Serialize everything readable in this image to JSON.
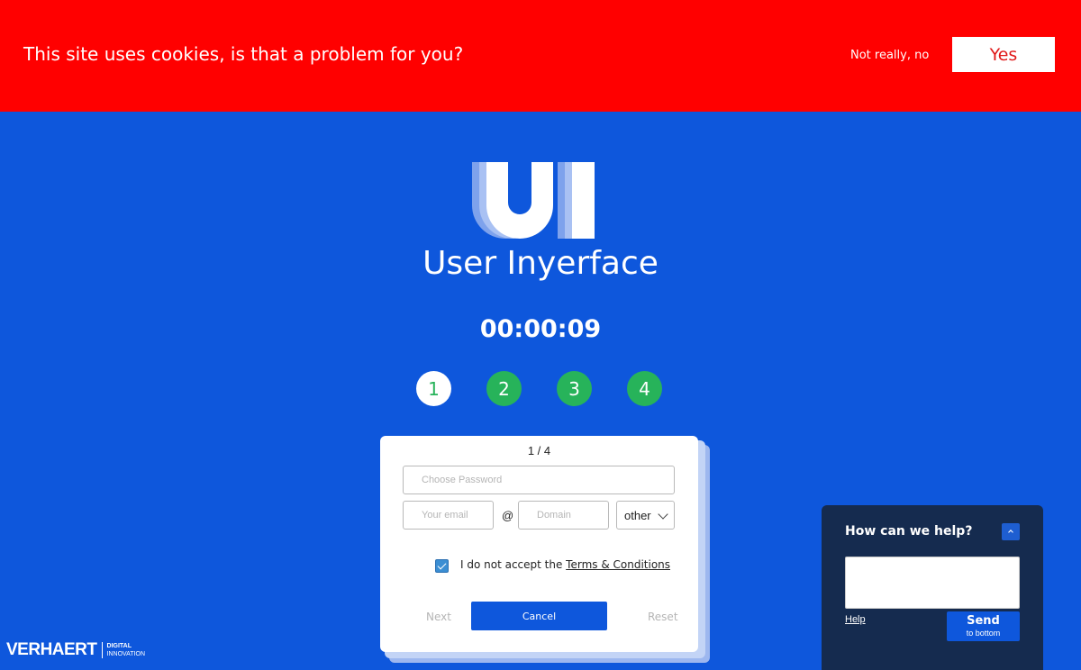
{
  "cookie_banner": {
    "message": "This site uses cookies, is that a problem for you?",
    "decline_label": "Not really, no",
    "accept_label": "Yes"
  },
  "app": {
    "title": "User Inyerface",
    "logo_icon": "ui-logo",
    "timer": "00:00:09"
  },
  "steps": [
    {
      "label": "1",
      "state": "active"
    },
    {
      "label": "2",
      "state": "todo"
    },
    {
      "label": "3",
      "state": "todo"
    },
    {
      "label": "4",
      "state": "todo"
    }
  ],
  "form": {
    "step_indicator": "1 / 4",
    "password_placeholder": "Choose Password",
    "email_placeholder": "Your email",
    "at_symbol": "@",
    "domain_placeholder": "Domain",
    "tld_selected": "other",
    "terms_checked": true,
    "terms_prefix": "I do not accept the ",
    "terms_link": "Terms & Conditions",
    "next_label": "Next",
    "cancel_label": "Cancel",
    "reset_label": "Reset"
  },
  "brand": {
    "name": "VERHAERT",
    "sub_line1": "DIGITAL",
    "sub_line2": "INNOVATION"
  },
  "help_widget": {
    "title": "How can we help?",
    "help_link": "Help",
    "send_label": "Send",
    "send_sublabel": "to bottom"
  },
  "colors": {
    "background": "#0e57dc",
    "cookie_bar": "#ff0000",
    "step_green": "#27b35a",
    "help_widget_bg": "#152b4f"
  }
}
